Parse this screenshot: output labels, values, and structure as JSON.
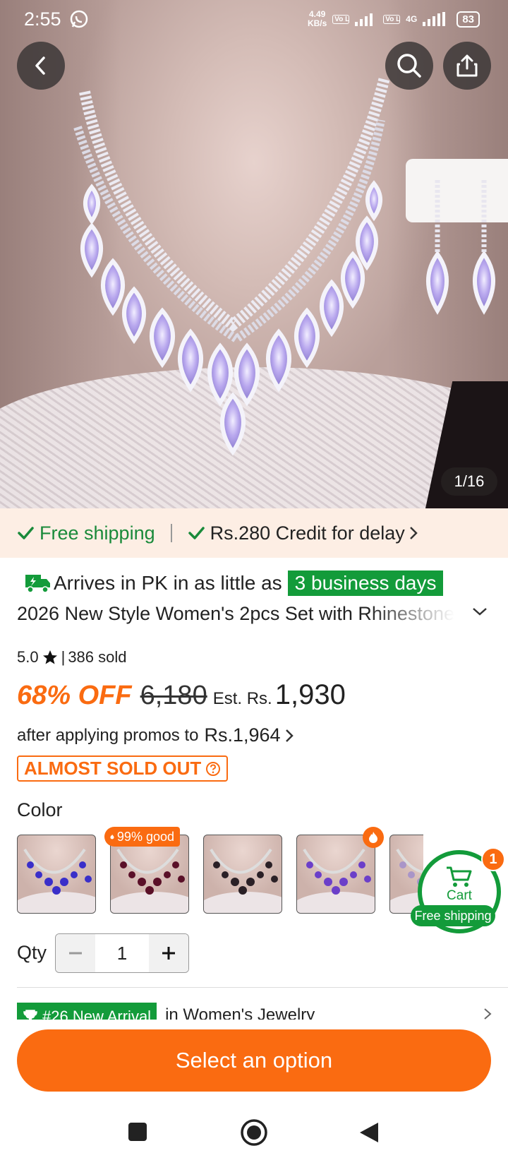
{
  "status_bar": {
    "time": "2:55",
    "net_speed": "4.49",
    "net_unit": "KB/s",
    "volte1": "Vo LTE",
    "volte2": "Vo LTE",
    "network": "4G",
    "battery": "83"
  },
  "gallery": {
    "page_indicator": "1/16"
  },
  "shipping_banner": {
    "free_shipping": "Free shipping",
    "credit": "Rs.280 Credit for delay"
  },
  "delivery": {
    "prefix": "Arrives in PK in as little as",
    "days": "3 business days"
  },
  "product": {
    "title": "2026 New Style Women's 2pcs Set with Rhinestone",
    "rating": "5.0",
    "sold": "386 sold",
    "discount": "68% OFF",
    "original_price": "6,180",
    "est_label": "Est. Rs.",
    "final_price": "1,930",
    "promo_text": "after applying promos to",
    "promo_price": "Rs.1,964",
    "almost_sold_out": "ALMOST SOLD OUT"
  },
  "color": {
    "label": "Color",
    "badge_text": "99% good",
    "swatches": [
      "royal-blue",
      "burgundy",
      "black",
      "violet",
      "lilac"
    ]
  },
  "cart": {
    "label": "Cart",
    "count": "1",
    "free_shipping": "Free shipping"
  },
  "quantity": {
    "label": "Qty",
    "value": "1"
  },
  "ranking": {
    "badge": "#26 New Arrival",
    "text": "in Women's Jewelry"
  },
  "cta": {
    "label": "Select an option"
  },
  "colors": {
    "accent_orange": "#fa6b11",
    "accent_green": "#139b3a",
    "banner_bg": "#fdeee4"
  }
}
